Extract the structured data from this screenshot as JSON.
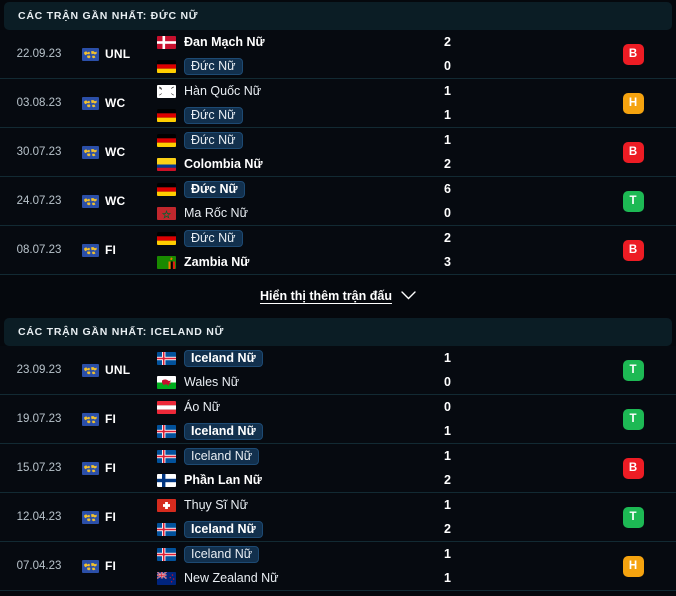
{
  "sections": [
    {
      "header": "CÁC TRẬN GẦN NHẤT: ĐỨC NỮ",
      "matches": [
        {
          "date": "22.09.23",
          "competition": "UNL",
          "competition_icon": "world-icon",
          "home": {
            "name": "Đan Mạch Nữ",
            "flag": "denmark",
            "score": "2",
            "winner": true,
            "highlight": false
          },
          "away": {
            "name": "Đức Nữ",
            "flag": "germany",
            "score": "0",
            "winner": false,
            "highlight": true
          },
          "result": "B",
          "result_color": "#ed1c24"
        },
        {
          "date": "03.08.23",
          "competition": "WC",
          "competition_icon": "world-icon",
          "home": {
            "name": "Hàn Quốc Nữ",
            "flag": "southkorea",
            "score": "1",
            "winner": false,
            "highlight": false
          },
          "away": {
            "name": "Đức Nữ",
            "flag": "germany",
            "score": "1",
            "winner": false,
            "highlight": true
          },
          "result": "H",
          "result_color": "#f5a30f"
        },
        {
          "date": "30.07.23",
          "competition": "WC",
          "competition_icon": "world-icon",
          "home": {
            "name": "Đức Nữ",
            "flag": "germany",
            "score": "1",
            "winner": false,
            "highlight": true
          },
          "away": {
            "name": "Colombia Nữ",
            "flag": "colombia",
            "score": "2",
            "winner": true,
            "highlight": false
          },
          "result": "B",
          "result_color": "#ed1c24"
        },
        {
          "date": "24.07.23",
          "competition": "WC",
          "competition_icon": "world-icon",
          "home": {
            "name": "Đức Nữ",
            "flag": "germany",
            "score": "6",
            "winner": true,
            "highlight": true
          },
          "away": {
            "name": "Ma Rốc Nữ",
            "flag": "morocco",
            "score": "0",
            "winner": false,
            "highlight": false
          },
          "result": "T",
          "result_color": "#1db954"
        },
        {
          "date": "08.07.23",
          "competition": "FI",
          "competition_icon": "world-icon",
          "home": {
            "name": "Đức Nữ",
            "flag": "germany",
            "score": "2",
            "winner": false,
            "highlight": true
          },
          "away": {
            "name": "Zambia Nữ",
            "flag": "zambia",
            "score": "3",
            "winner": true,
            "highlight": false
          },
          "result": "B",
          "result_color": "#ed1c24"
        }
      ],
      "show_more": {
        "label": "Hiển thị thêm trận đấu",
        "icon": "chevron-down-icon"
      }
    },
    {
      "header": "CÁC TRẬN GẦN NHẤT: ICELAND NỮ",
      "matches": [
        {
          "date": "23.09.23",
          "competition": "UNL",
          "competition_icon": "world-icon",
          "home": {
            "name": "Iceland Nữ",
            "flag": "iceland",
            "score": "1",
            "winner": true,
            "highlight": true
          },
          "away": {
            "name": "Wales Nữ",
            "flag": "wales",
            "score": "0",
            "winner": false,
            "highlight": false
          },
          "result": "T",
          "result_color": "#1db954"
        },
        {
          "date": "19.07.23",
          "competition": "FI",
          "competition_icon": "world-icon",
          "home": {
            "name": "Áo Nữ",
            "flag": "austria",
            "score": "0",
            "winner": false,
            "highlight": false
          },
          "away": {
            "name": "Iceland Nữ",
            "flag": "iceland",
            "score": "1",
            "winner": true,
            "highlight": true
          },
          "result": "T",
          "result_color": "#1db954"
        },
        {
          "date": "15.07.23",
          "competition": "FI",
          "competition_icon": "world-icon",
          "home": {
            "name": "Iceland Nữ",
            "flag": "iceland",
            "score": "1",
            "winner": false,
            "highlight": true
          },
          "away": {
            "name": "Phần Lan Nữ",
            "flag": "finland",
            "score": "2",
            "winner": true,
            "highlight": false
          },
          "result": "B",
          "result_color": "#ed1c24"
        },
        {
          "date": "12.04.23",
          "competition": "FI",
          "competition_icon": "world-icon",
          "home": {
            "name": "Thụy Sĩ Nữ",
            "flag": "switzerland",
            "score": "1",
            "winner": false,
            "highlight": false
          },
          "away": {
            "name": "Iceland Nữ",
            "flag": "iceland",
            "score": "2",
            "winner": true,
            "highlight": true
          },
          "result": "T",
          "result_color": "#1db954"
        },
        {
          "date": "07.04.23",
          "competition": "FI",
          "competition_icon": "world-icon",
          "home": {
            "name": "Iceland Nữ",
            "flag": "iceland",
            "score": "1",
            "winner": false,
            "highlight": true
          },
          "away": {
            "name": "New Zealand Nữ",
            "flag": "newzealand",
            "score": "1",
            "winner": false,
            "highlight": false
          },
          "result": "H",
          "result_color": "#f5a30f"
        }
      ]
    }
  ],
  "colors": {
    "background": "#05080d",
    "row_background": "#060a10",
    "header_background": "#0b1d25",
    "divider": "#122a33",
    "highlight_background": "#12304d",
    "win": "#ed1c24",
    "draw": "#f5a30f",
    "loss": "#1db954"
  }
}
